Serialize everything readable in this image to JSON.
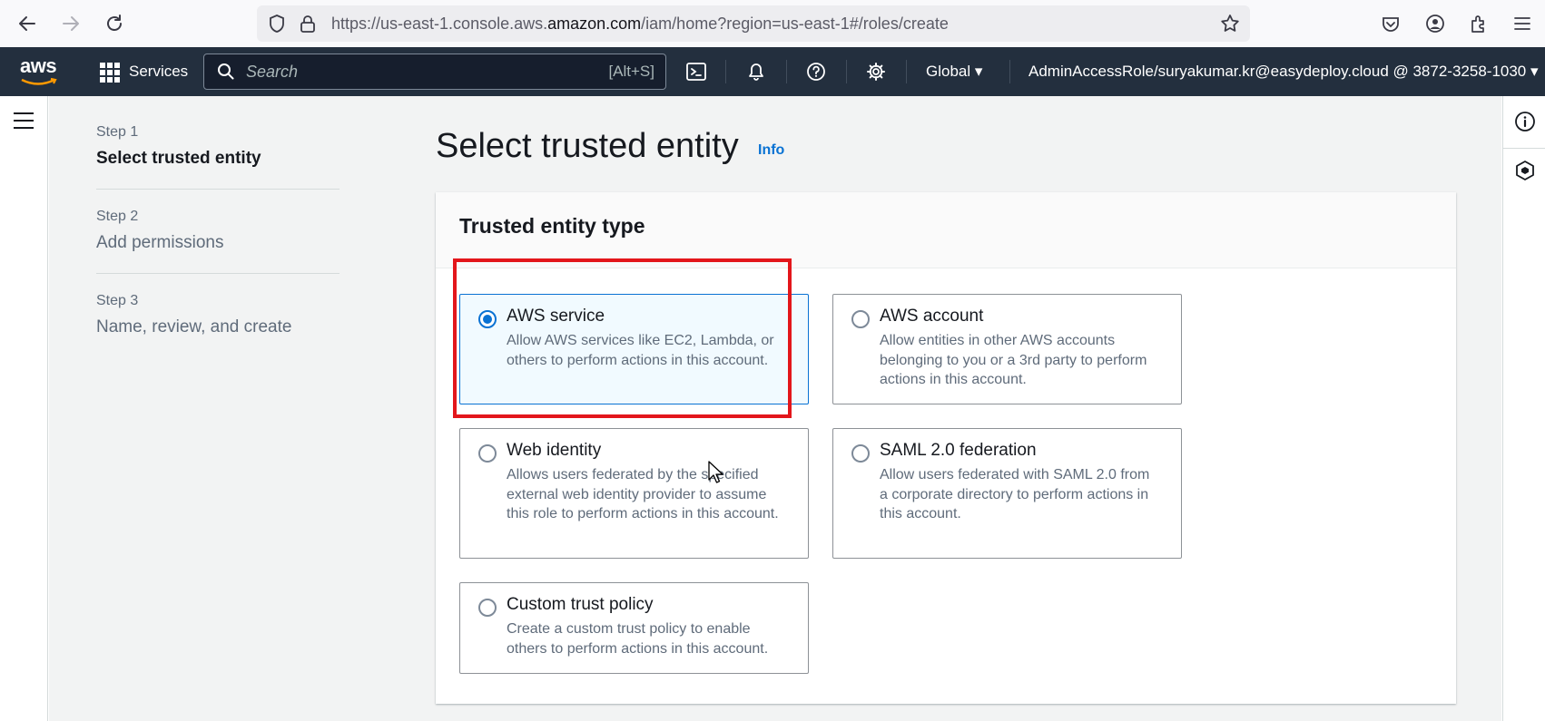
{
  "browser": {
    "url_prefix": "https://us-east-1.console.aws.",
    "url_domain": "amazon.com",
    "url_path": "/iam/home?region=us-east-1#/roles/create"
  },
  "nav": {
    "logo": "aws",
    "services_label": "Services",
    "search_placeholder": "Search",
    "search_shortcut": "[Alt+S]",
    "region": "Global ▾",
    "account": "AdminAccessRole/suryakumar.kr@easydeploy.cloud @ 3872-3258-1030 ▾"
  },
  "steps": [
    {
      "num": "Step 1",
      "title": "Select trusted entity",
      "active": true
    },
    {
      "num": "Step 2",
      "title": "Add permissions",
      "active": false
    },
    {
      "num": "Step 3",
      "title": "Name, review, and create",
      "active": false
    }
  ],
  "page": {
    "title": "Select trusted entity",
    "info": "Info"
  },
  "panel": {
    "title": "Trusted entity type",
    "options": [
      {
        "title": "AWS service",
        "desc": "Allow AWS services like EC2, Lambda, or others to perform actions in this account.",
        "selected": true
      },
      {
        "title": "AWS account",
        "desc": "Allow entities in other AWS accounts belonging to you or a 3rd party to perform actions in this account.",
        "selected": false
      },
      {
        "title": "Web identity",
        "desc": "Allows users federated by the specified external web identity provider to assume this role to perform actions in this account.",
        "selected": false
      },
      {
        "title": "SAML 2.0 federation",
        "desc": "Allow users federated with SAML 2.0 from a corporate directory to perform actions in this account.",
        "selected": false
      },
      {
        "title": "Custom trust policy",
        "desc": "Create a custom trust policy to enable others to perform actions in this account.",
        "selected": false
      }
    ]
  },
  "colors": {
    "nav_bg": "#232f3e",
    "accent": "#0972d3",
    "highlight": "#e3161b"
  }
}
